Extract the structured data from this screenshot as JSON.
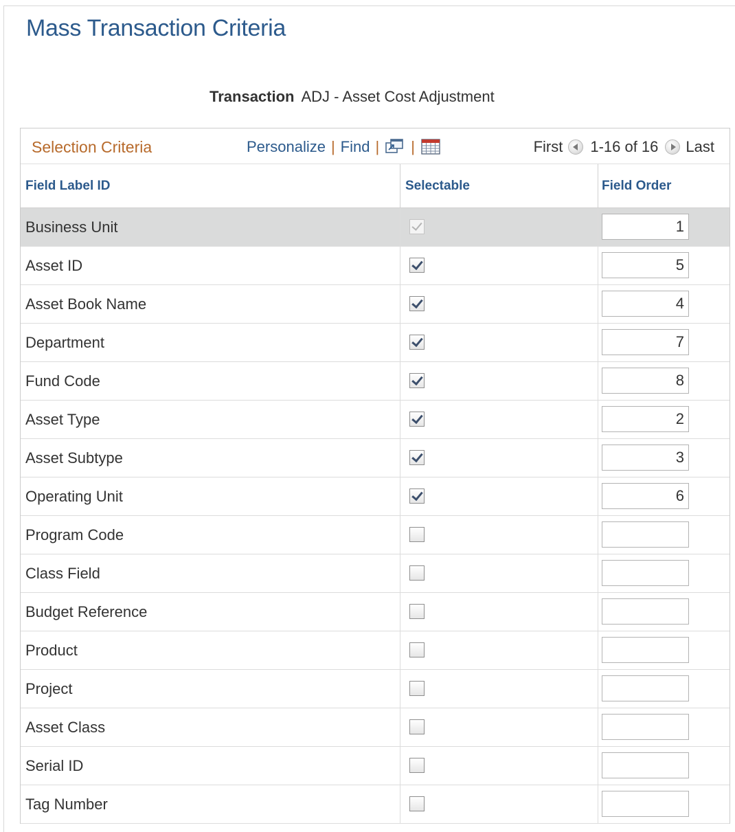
{
  "page": {
    "title": "Mass Transaction Criteria"
  },
  "transaction": {
    "label": "Transaction",
    "value": "ADJ - Asset Cost Adjustment"
  },
  "grid": {
    "title": "Selection Criteria",
    "nav": {
      "personalize": "Personalize",
      "find": "Find",
      "separator": "|"
    },
    "pager": {
      "first": "First",
      "range": "1-16 of 16",
      "last": "Last"
    },
    "columns": {
      "field_label": "Field Label ID",
      "selectable": "Selectable",
      "field_order": "Field Order"
    },
    "rows": [
      {
        "label": "Business Unit",
        "checked": true,
        "disabled": true,
        "order": "1"
      },
      {
        "label": "Asset ID",
        "checked": true,
        "disabled": false,
        "order": "5"
      },
      {
        "label": "Asset Book Name",
        "checked": true,
        "disabled": false,
        "order": "4"
      },
      {
        "label": "Department",
        "checked": true,
        "disabled": false,
        "order": "7"
      },
      {
        "label": "Fund Code",
        "checked": true,
        "disabled": false,
        "order": "8"
      },
      {
        "label": "Asset Type",
        "checked": true,
        "disabled": false,
        "order": "2"
      },
      {
        "label": "Asset Subtype",
        "checked": true,
        "disabled": false,
        "order": "3"
      },
      {
        "label": "Operating Unit",
        "checked": true,
        "disabled": false,
        "order": "6"
      },
      {
        "label": "Program Code",
        "checked": false,
        "disabled": false,
        "order": ""
      },
      {
        "label": "Class Field",
        "checked": false,
        "disabled": false,
        "order": ""
      },
      {
        "label": "Budget Reference",
        "checked": false,
        "disabled": false,
        "order": ""
      },
      {
        "label": "Product",
        "checked": false,
        "disabled": false,
        "order": ""
      },
      {
        "label": "Project",
        "checked": false,
        "disabled": false,
        "order": ""
      },
      {
        "label": "Asset Class",
        "checked": false,
        "disabled": false,
        "order": ""
      },
      {
        "label": "Serial ID",
        "checked": false,
        "disabled": false,
        "order": ""
      },
      {
        "label": "Tag Number",
        "checked": false,
        "disabled": false,
        "order": ""
      }
    ]
  },
  "icons": {
    "zoom": "new-window-icon",
    "download": "spreadsheet-icon",
    "prev": "previous-arrow-icon",
    "next": "next-arrow-icon",
    "checkbox": "checkbox-icon"
  },
  "colors": {
    "title": "#2c5a8c",
    "grid_title": "#b76a2b",
    "link": "#2c5a8c",
    "header_text": "#2c5a8c",
    "highlight_row": "#dadbdb"
  }
}
